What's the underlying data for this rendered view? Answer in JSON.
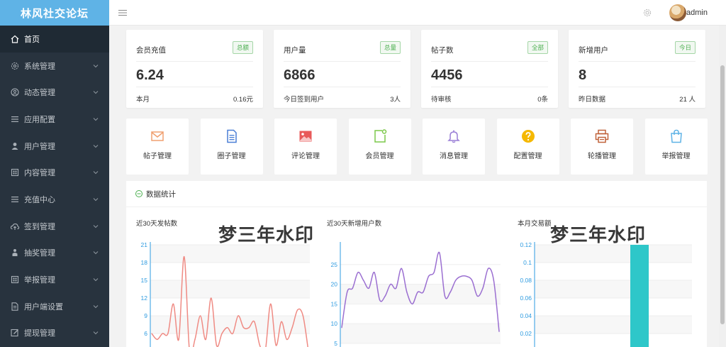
{
  "brand": "林风社交论坛",
  "sidebar": {
    "items": [
      {
        "label": "首页",
        "icon": "home-icon",
        "active": true
      },
      {
        "label": "系统管理",
        "icon": "settings-icon"
      },
      {
        "label": "动态管理",
        "icon": "user-circle-icon"
      },
      {
        "label": "应用配置",
        "icon": "list-icon"
      },
      {
        "label": "用户管理",
        "icon": "user-icon"
      },
      {
        "label": "内容管理",
        "icon": "grid-icon"
      },
      {
        "label": "充值中心",
        "icon": "list-icon"
      },
      {
        "label": "签到管理",
        "icon": "cloud-upload-icon"
      },
      {
        "label": "抽奖管理",
        "icon": "user-group-icon"
      },
      {
        "label": "举报管理",
        "icon": "grid-icon"
      },
      {
        "label": "用户端设置",
        "icon": "document-icon"
      },
      {
        "label": "提现管理",
        "icon": "edit-icon"
      }
    ]
  },
  "header": {
    "user": "admin"
  },
  "stats": [
    {
      "title": "会员充值",
      "badge": "总额",
      "value": "6.24",
      "foot_label": "本月",
      "foot_value": "0.16元"
    },
    {
      "title": "用户量",
      "badge": "总量",
      "value": "6866",
      "foot_label": "今日签到用户",
      "foot_value": "3人"
    },
    {
      "title": "帖子数",
      "badge": "全部",
      "value": "4456",
      "foot_label": "待审核",
      "foot_value": "0条"
    },
    {
      "title": "新增用户",
      "badge": "今日",
      "value": "8",
      "foot_label": "昨日数据",
      "foot_value": "21 人"
    }
  ],
  "tiles": [
    {
      "label": "帖子管理",
      "icon": "mail-icon",
      "color": "#f0a070"
    },
    {
      "label": "圈子管理",
      "icon": "document-icon",
      "color": "#4a7fd6"
    },
    {
      "label": "评论管理",
      "icon": "image-icon",
      "color": "#e85a5a"
    },
    {
      "label": "会员管理",
      "icon": "member-icon",
      "color": "#7cc84a"
    },
    {
      "label": "消息管理",
      "icon": "bell-icon",
      "color": "#9a7fd6"
    },
    {
      "label": "配置管理",
      "icon": "question-icon",
      "color": "#f5b800"
    },
    {
      "label": "轮播管理",
      "icon": "printer-icon",
      "color": "#c0623a"
    },
    {
      "label": "举报管理",
      "icon": "bag-icon",
      "color": "#5fb3e6"
    }
  ],
  "panel": {
    "title": "数据统计"
  },
  "watermark": "梦三年水印",
  "chart_data": [
    {
      "type": "line",
      "title": "近30天发帖数",
      "ylim": [
        3,
        21
      ],
      "yticks": [
        3,
        6,
        9,
        12,
        15,
        18,
        21
      ],
      "color": "#ef8b84",
      "values": [
        6,
        5,
        6,
        6,
        11,
        5,
        19,
        3,
        5,
        9,
        5,
        12,
        4,
        6,
        7,
        6,
        9,
        7,
        7,
        8,
        4,
        3,
        11,
        4,
        8,
        5,
        7,
        10,
        9,
        3
      ]
    },
    {
      "type": "line",
      "title": "近30天新增用户数",
      "ylim": [
        3,
        30
      ],
      "yticks": [
        5,
        10,
        15,
        20,
        25
      ],
      "color": "#9b6fd1",
      "values": [
        9,
        18,
        19,
        23,
        21,
        19,
        23,
        16,
        17,
        20,
        19,
        24,
        18,
        15,
        18,
        18,
        22,
        23,
        28,
        17,
        18,
        21,
        22,
        22,
        21,
        17,
        19,
        24,
        21,
        8
      ]
    },
    {
      "type": "bar",
      "title": "本月交易额",
      "ylim": [
        0,
        0.12
      ],
      "yticks": [
        0.02,
        0.04,
        0.06,
        0.08,
        0.1,
        0.12
      ],
      "color": "#2ec7c9",
      "values": [
        0.12
      ]
    }
  ]
}
